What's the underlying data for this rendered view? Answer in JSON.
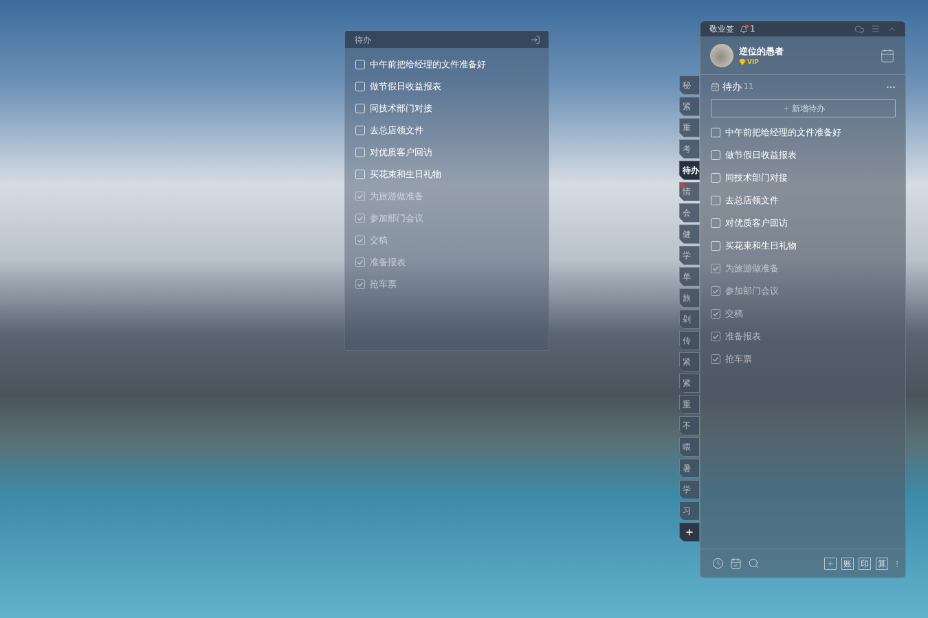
{
  "widget_panel": {
    "title": "待办",
    "items": [
      {
        "text": "中午前把给经理的文件准备好",
        "checked": false
      },
      {
        "text": "做节假日收益报表",
        "checked": false
      },
      {
        "text": "同技术部门对接",
        "checked": false
      },
      {
        "text": "去总店领文件",
        "checked": false
      },
      {
        "text": "对优质客户回访",
        "checked": false
      },
      {
        "text": "买花束和生日礼物",
        "checked": false
      },
      {
        "text": "为旅游做准备",
        "checked": true
      },
      {
        "text": "参加部门会议",
        "checked": true
      },
      {
        "text": "交稿",
        "checked": true
      },
      {
        "text": "准备报表",
        "checked": true
      },
      {
        "text": "抢车票",
        "checked": true
      }
    ]
  },
  "category_tabs": [
    {
      "label": "秘",
      "selected": false,
      "alert": false
    },
    {
      "label": "紧",
      "selected": false,
      "alert": false
    },
    {
      "label": "重",
      "selected": false,
      "alert": false
    },
    {
      "label": "考",
      "selected": false,
      "alert": false
    },
    {
      "label": "待办",
      "selected": true,
      "alert": false
    },
    {
      "label": "情",
      "selected": false,
      "alert": true
    },
    {
      "label": "会",
      "selected": false,
      "alert": false
    },
    {
      "label": "健",
      "selected": false,
      "alert": false
    },
    {
      "label": "学",
      "selected": false,
      "alert": false
    },
    {
      "label": "单",
      "selected": false,
      "alert": false
    },
    {
      "label": "旅",
      "selected": false,
      "alert": false
    },
    {
      "label": "剁",
      "selected": false,
      "alert": false
    },
    {
      "label": "传",
      "selected": false,
      "alert": false
    },
    {
      "label": "紧",
      "selected": false,
      "alert": false
    },
    {
      "label": "紧",
      "selected": false,
      "alert": false
    },
    {
      "label": "重",
      "selected": false,
      "alert": false
    },
    {
      "label": "不",
      "selected": false,
      "alert": false
    },
    {
      "label": "喂",
      "selected": false,
      "alert": false
    },
    {
      "label": "暑",
      "selected": false,
      "alert": false
    },
    {
      "label": "学",
      "selected": false,
      "alert": false
    },
    {
      "label": "习",
      "selected": false,
      "alert": false
    }
  ],
  "main_panel": {
    "app_name": "敬业签",
    "notifications": {
      "count": "1",
      "unread": true
    },
    "user": {
      "name": "逆位的愚者",
      "badge": "VIP"
    },
    "list": {
      "title": "待办",
      "count": "11",
      "add_button": "新增待办",
      "items": [
        {
          "text": "中午前把给经理的文件准备好",
          "checked": false
        },
        {
          "text": "做节假日收益报表",
          "checked": false
        },
        {
          "text": "同技术部门对接",
          "checked": false
        },
        {
          "text": "去总店领文件",
          "checked": false
        },
        {
          "text": "对优质客户回访",
          "checked": false
        },
        {
          "text": "买花束和生日礼物",
          "checked": false
        },
        {
          "text": "为旅游做准备",
          "checked": true
        },
        {
          "text": "参加部门会议",
          "checked": true
        },
        {
          "text": "交稿",
          "checked": true
        },
        {
          "text": "准备报表",
          "checked": true
        },
        {
          "text": "抢车票",
          "checked": true
        }
      ]
    },
    "text_tools": [
      "账",
      "印",
      "算"
    ]
  }
}
